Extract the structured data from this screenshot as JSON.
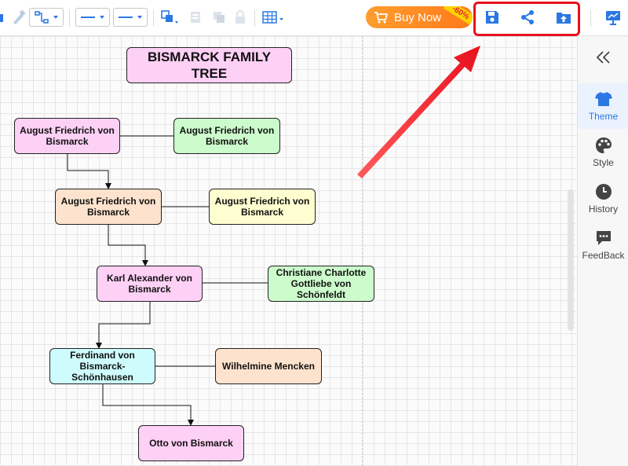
{
  "toolbar": {
    "buy_now": {
      "label": "Buy Now",
      "discount": "-60%"
    }
  },
  "right_panel": {
    "items": [
      {
        "label": "Theme",
        "icon": "shirt-icon",
        "active": true
      },
      {
        "label": "Style",
        "icon": "palette-icon",
        "active": false
      },
      {
        "label": "History",
        "icon": "clock-icon",
        "active": false
      },
      {
        "label": "FeedBack",
        "icon": "chat-icon",
        "active": false
      }
    ]
  },
  "diagram": {
    "title": "BISMARCK FAMILY TREE",
    "nodes": {
      "n1": "August Friedrich von Bismarck",
      "n2": "August Friedrich von Bismarck",
      "n3": "August Friedrich von Bismarck",
      "n4": "August Friedrich von Bismarck",
      "n5": "Karl Alexander von Bismarck",
      "n6": "Christiane Charlotte Gottliebe von Schönfeldt",
      "n7": "Ferdinand von Bismarck-Schönhausen",
      "n8": "Wilhelmine Mencken",
      "n9": "Otto von Bismarck"
    }
  },
  "colors": {
    "accent": "#2b78e4",
    "highlight_red": "#e8101e",
    "buy_now": "#ff8a22",
    "node_pink": "#fdd0f5",
    "node_green": "#ccfbcc",
    "node_peach": "#fde3cd",
    "node_yellow": "#fefed0",
    "node_cyan": "#cefcfc"
  }
}
